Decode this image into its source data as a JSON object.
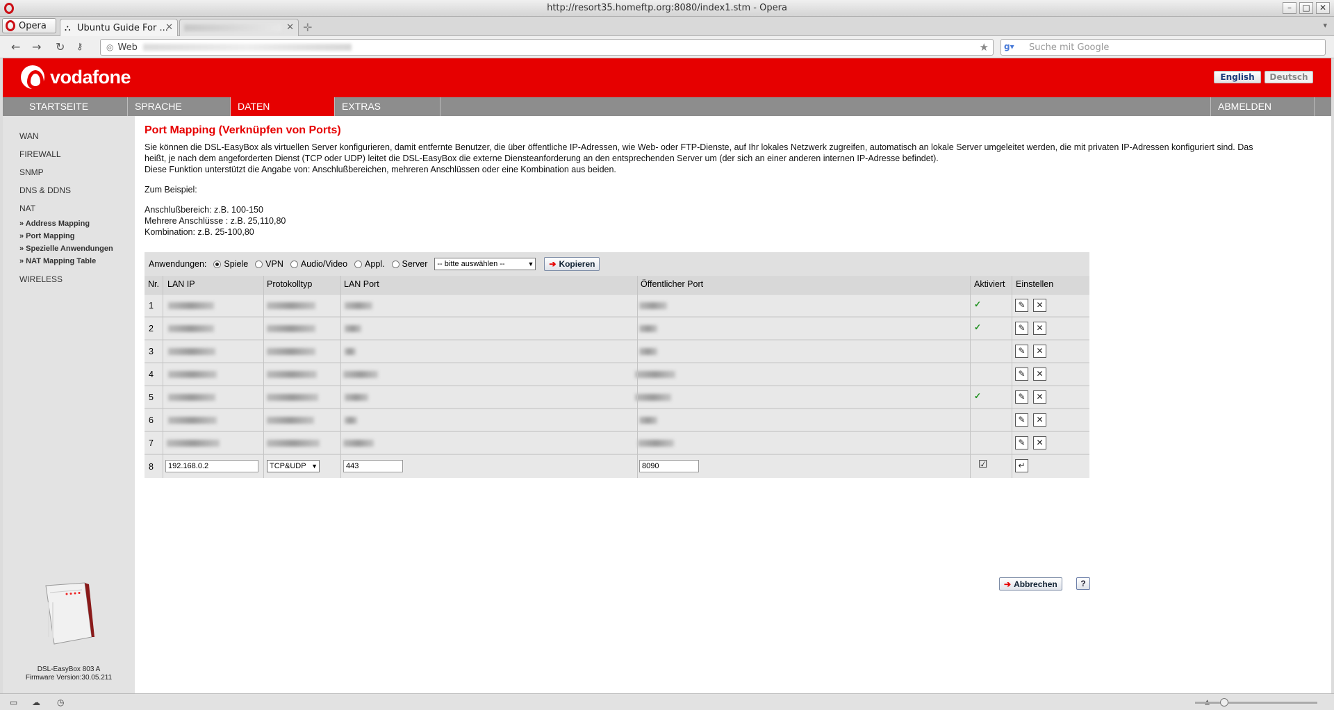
{
  "window": {
    "title": "http://resort35.homeftp.org:8080/index1.stm - Opera"
  },
  "tabs": [
    {
      "label": "Opera"
    },
    {
      "label": "Ubuntu Guide For ..."
    }
  ],
  "address_prefix": "Web",
  "search_placeholder": "Suche mit Google",
  "header": {
    "brand": "vodafone",
    "lang_en": "English",
    "lang_de": "Deutsch"
  },
  "topnav": [
    "STARTSEITE",
    "SPRACHE",
    "DATEN",
    "EXTRAS",
    "ABMELDEN"
  ],
  "sidebar": {
    "items": [
      "WAN",
      "FIREWALL",
      "SNMP",
      "DNS & DDNS",
      "NAT",
      "WIRELESS"
    ],
    "subitems": [
      "» Address Mapping",
      "» Port Mapping",
      "» Spezielle Anwendungen",
      "» NAT Mapping Table"
    ],
    "device_name": "DSL-EasyBox 803 A",
    "firmware": "Firmware Version:30.05.211"
  },
  "main": {
    "title": "Port Mapping (Verknüpfen von Ports)",
    "desc1": "Sie können die DSL-EasyBox als virtuellen Server konfigurieren, damit entfernte Benutzer, die über öffentliche IP-Adressen, wie Web- oder FTP-Dienste, auf Ihr lokales Netzwerk zugreifen, automatisch an lokale Server umgeleitet werden, die mit privaten IP-Adressen konfiguriert sind. Das",
    "desc2": "heißt, je nach dem angeforderten Dienst (TCP oder UDP) leitet die DSL-EasyBox die externe Diensteanforderung an den entsprechenden Server um (der sich an einer anderen internen IP-Adresse befindet).",
    "desc3": "Diese Funktion unterstützt die Angabe von: Anschlußbereichen, mehreren Anschlüssen oder eine Kombination aus beiden.",
    "example_label": "Zum Beispiel:",
    "ex1": "Anschlußbereich: z.B. 100-150",
    "ex2": "Mehrere Anschlüsse : z.B. 25,110,80",
    "ex3": "Kombination: z.B. 25-100,80"
  },
  "apps": {
    "label": "Anwendungen:",
    "options": [
      "Spiele",
      "VPN",
      "Audio/Video",
      "Appl.",
      "Server"
    ],
    "selected": "Spiele",
    "select_value": "-- bitte auswählen --",
    "copy_button": "Kopieren"
  },
  "table": {
    "headers": [
      "Nr.",
      "LAN IP",
      "Protokolltyp",
      "LAN Port",
      "Öffentlicher Port",
      "Aktiviert",
      "Einstellen"
    ],
    "rows": [
      {
        "nr": "1",
        "active": true
      },
      {
        "nr": "2",
        "active": true
      },
      {
        "nr": "3",
        "active": false
      },
      {
        "nr": "4",
        "active": false
      },
      {
        "nr": "5",
        "active": true
      },
      {
        "nr": "6",
        "active": false
      },
      {
        "nr": "7",
        "active": false
      }
    ],
    "new_row": {
      "nr": "8",
      "lan_ip": "192.168.0.2",
      "protocol": "TCP&UDP",
      "lan_port": "443",
      "public_port": "8090",
      "active": true
    }
  },
  "cancel_button": "Abbrechen",
  "help_button": "?",
  "colors": {
    "brand_red": "#e60000",
    "nav_grey": "#8d8d8d"
  }
}
